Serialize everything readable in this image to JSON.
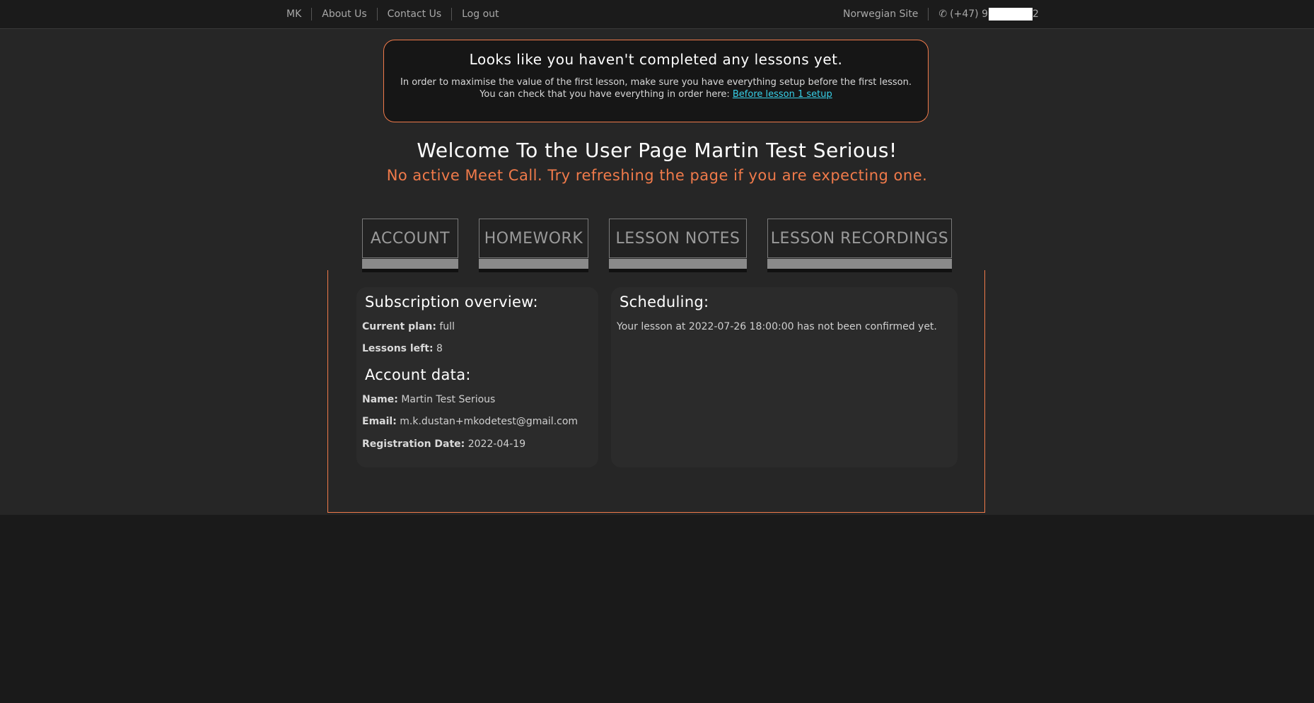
{
  "nav": {
    "left": [
      "MK",
      "About Us",
      "Contact Us",
      "Log out"
    ],
    "right": {
      "site_link": "Norwegian Site",
      "phone_prefix": "(+47) 9",
      "phone_suffix": "2"
    }
  },
  "notice": {
    "title": "Looks like you haven't completed any lessons yet.",
    "line1": "In order to maximise the value of the first lesson, make sure you have everything setup before the first lesson.",
    "line2": "You can check that you have everything in order here: ",
    "link": "Before lesson 1 setup"
  },
  "welcome": "Welcome To the User Page Martin Test Serious!",
  "meet_status": "No active Meet Call. Try refreshing the page if you are expecting one.",
  "tabs": [
    "ACCOUNT",
    "HOMEWORK",
    "LESSON NOTES",
    "LESSON RECORDINGS"
  ],
  "subscription": {
    "heading": "Subscription overview:",
    "plan_label": "Current plan:",
    "plan_value": "full",
    "lessons_label": "Lessons left:",
    "lessons_value": "8"
  },
  "account": {
    "heading": "Account data:",
    "name_label": "Name:",
    "name_value": "Martin Test Serious",
    "email_label": "Email:",
    "email_value": "m.k.dustan+mkodetest@gmail.com",
    "reg_label": "Registration Date:",
    "reg_value": "2022-04-19"
  },
  "scheduling": {
    "heading": "Scheduling:",
    "message": "Your lesson at 2022-07-26 18:00:00 has not been confirmed yet."
  },
  "colors": {
    "accent": "#f07a4a",
    "link": "#37d0e8",
    "background": "#262626"
  }
}
